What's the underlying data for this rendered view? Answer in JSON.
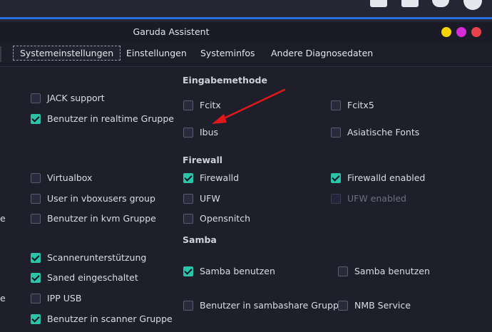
{
  "window": {
    "title": "Garuda Assistent"
  },
  "tabs": [
    {
      "label": "Systemeinstellungen"
    },
    {
      "label": "Einstellungen"
    },
    {
      "label": "Systeminfos"
    },
    {
      "label": "Andere Diagnosedaten"
    }
  ],
  "window_buttons": {
    "yellow": "#f5d400",
    "magenta": "#d62bd6",
    "red": "#e8434a"
  },
  "colors": {
    "accent": "#2bc4a9",
    "background": "#1f1f2c",
    "annotation_arrow": "#e01818"
  },
  "left_column": {
    "jack_support": {
      "label": "JACK support",
      "checked": false
    },
    "realtime_group": {
      "label": "Benutzer in realtime Gruppe",
      "checked": true
    },
    "virtualbox": {
      "label": "Virtualbox",
      "checked": false
    },
    "vboxusers_group": {
      "label": "User in vboxusers group",
      "checked": false
    },
    "kvm_group": {
      "label": "Benutzer in kvm Gruppe",
      "checked": false
    },
    "scanner_support": {
      "label": "Scannerunterstützung",
      "checked": true
    },
    "saned": {
      "label": "Saned eingeschaltet",
      "checked": true
    },
    "ipp_usb": {
      "label": "IPP USB",
      "checked": false
    },
    "scanner_group": {
      "label": "Benutzer in scanner Gruppe",
      "checked": true
    },
    "edge_fragment_1": "e",
    "edge_fragment_2": "e"
  },
  "input_method": {
    "header": "Eingabemethode",
    "fcitx": {
      "label": "Fcitx",
      "checked": false
    },
    "fcitx5": {
      "label": "Fcitx5",
      "checked": false
    },
    "ibus": {
      "label": "Ibus",
      "checked": false
    },
    "asian_fonts": {
      "label": "Asiatische Fonts",
      "checked": false
    }
  },
  "firewall": {
    "header": "Firewall",
    "firewalld": {
      "label": "Firewalld",
      "checked": true
    },
    "firewalld_enabled": {
      "label": "Firewalld enabled",
      "checked": true
    },
    "ufw": {
      "label": "UFW",
      "checked": false
    },
    "ufw_enabled": {
      "label": "UFW enabled",
      "checked": false,
      "disabled": true
    },
    "opensnitch": {
      "label": "Opensnitch",
      "checked": false
    }
  },
  "samba": {
    "header": "Samba",
    "samba_use": {
      "label": "Samba benutzen",
      "checked": true
    },
    "samba_use_2": {
      "label": "Samba benutzen",
      "checked": false
    },
    "sambashare_group": {
      "label": "Benutzer in sambashare Gruppe",
      "checked": false
    },
    "nmb_service": {
      "label": "NMB Service",
      "checked": false
    }
  }
}
